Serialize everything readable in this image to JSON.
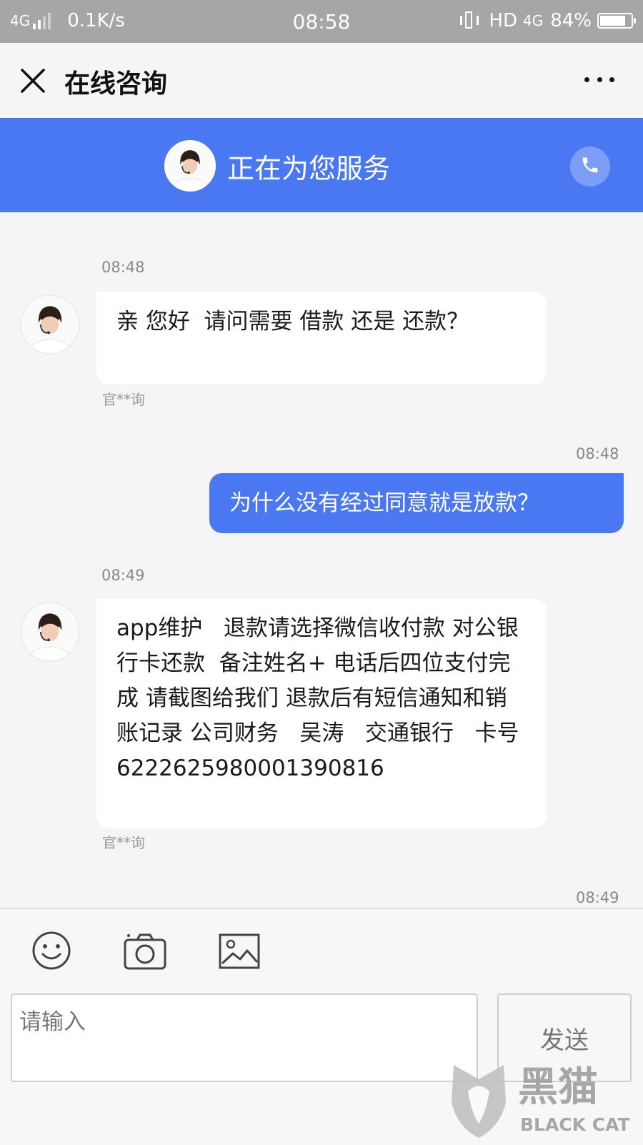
{
  "status_bar": {
    "network_left": "4G",
    "speed": "0.1K/s",
    "time": "08:58",
    "hd": "HD",
    "network_right": "4G",
    "battery_text": "84%",
    "battery_level": 0.84,
    "icons": [
      "signal-icon",
      "vibrate-icon",
      "battery-icon"
    ]
  },
  "header": {
    "title": "在线咨询",
    "close_icon": "close-icon",
    "more_icon": "more-icon"
  },
  "banner": {
    "title": "正在为您服务",
    "call_icon": "phone-icon",
    "color": "#4a78f2"
  },
  "messages": [
    {
      "time": "08:48",
      "direction": "incoming",
      "text": "亲 您好  请问需要 借款 还是 还款？",
      "sender": "官**询"
    },
    {
      "time": "08:48",
      "direction": "outgoing",
      "text": "为什么没有经过同意就是放款？"
    },
    {
      "time": "08:49",
      "direction": "incoming",
      "text": "app维护   退款请选择微信收付款 对公银行卡还款  备注姓名+ 电话后四位支付完成 请截图给我们 退款后有短信通知和销账记录 公司财务   吴涛   交通银行   卡号  6222625980001390816",
      "sender": "官**询"
    },
    {
      "time": "08:49"
    }
  ],
  "composer": {
    "icons": [
      "emoji-icon",
      "camera-icon",
      "image-icon"
    ],
    "placeholder": "请输入",
    "send_label": "发送"
  },
  "watermark": {
    "brand_cn": "黑猫",
    "brand_en": "BLACK CAT"
  },
  "colors": {
    "accent": "#4a78f2",
    "background": "#f5f5f5",
    "status_bar": "#a6a6a6"
  }
}
